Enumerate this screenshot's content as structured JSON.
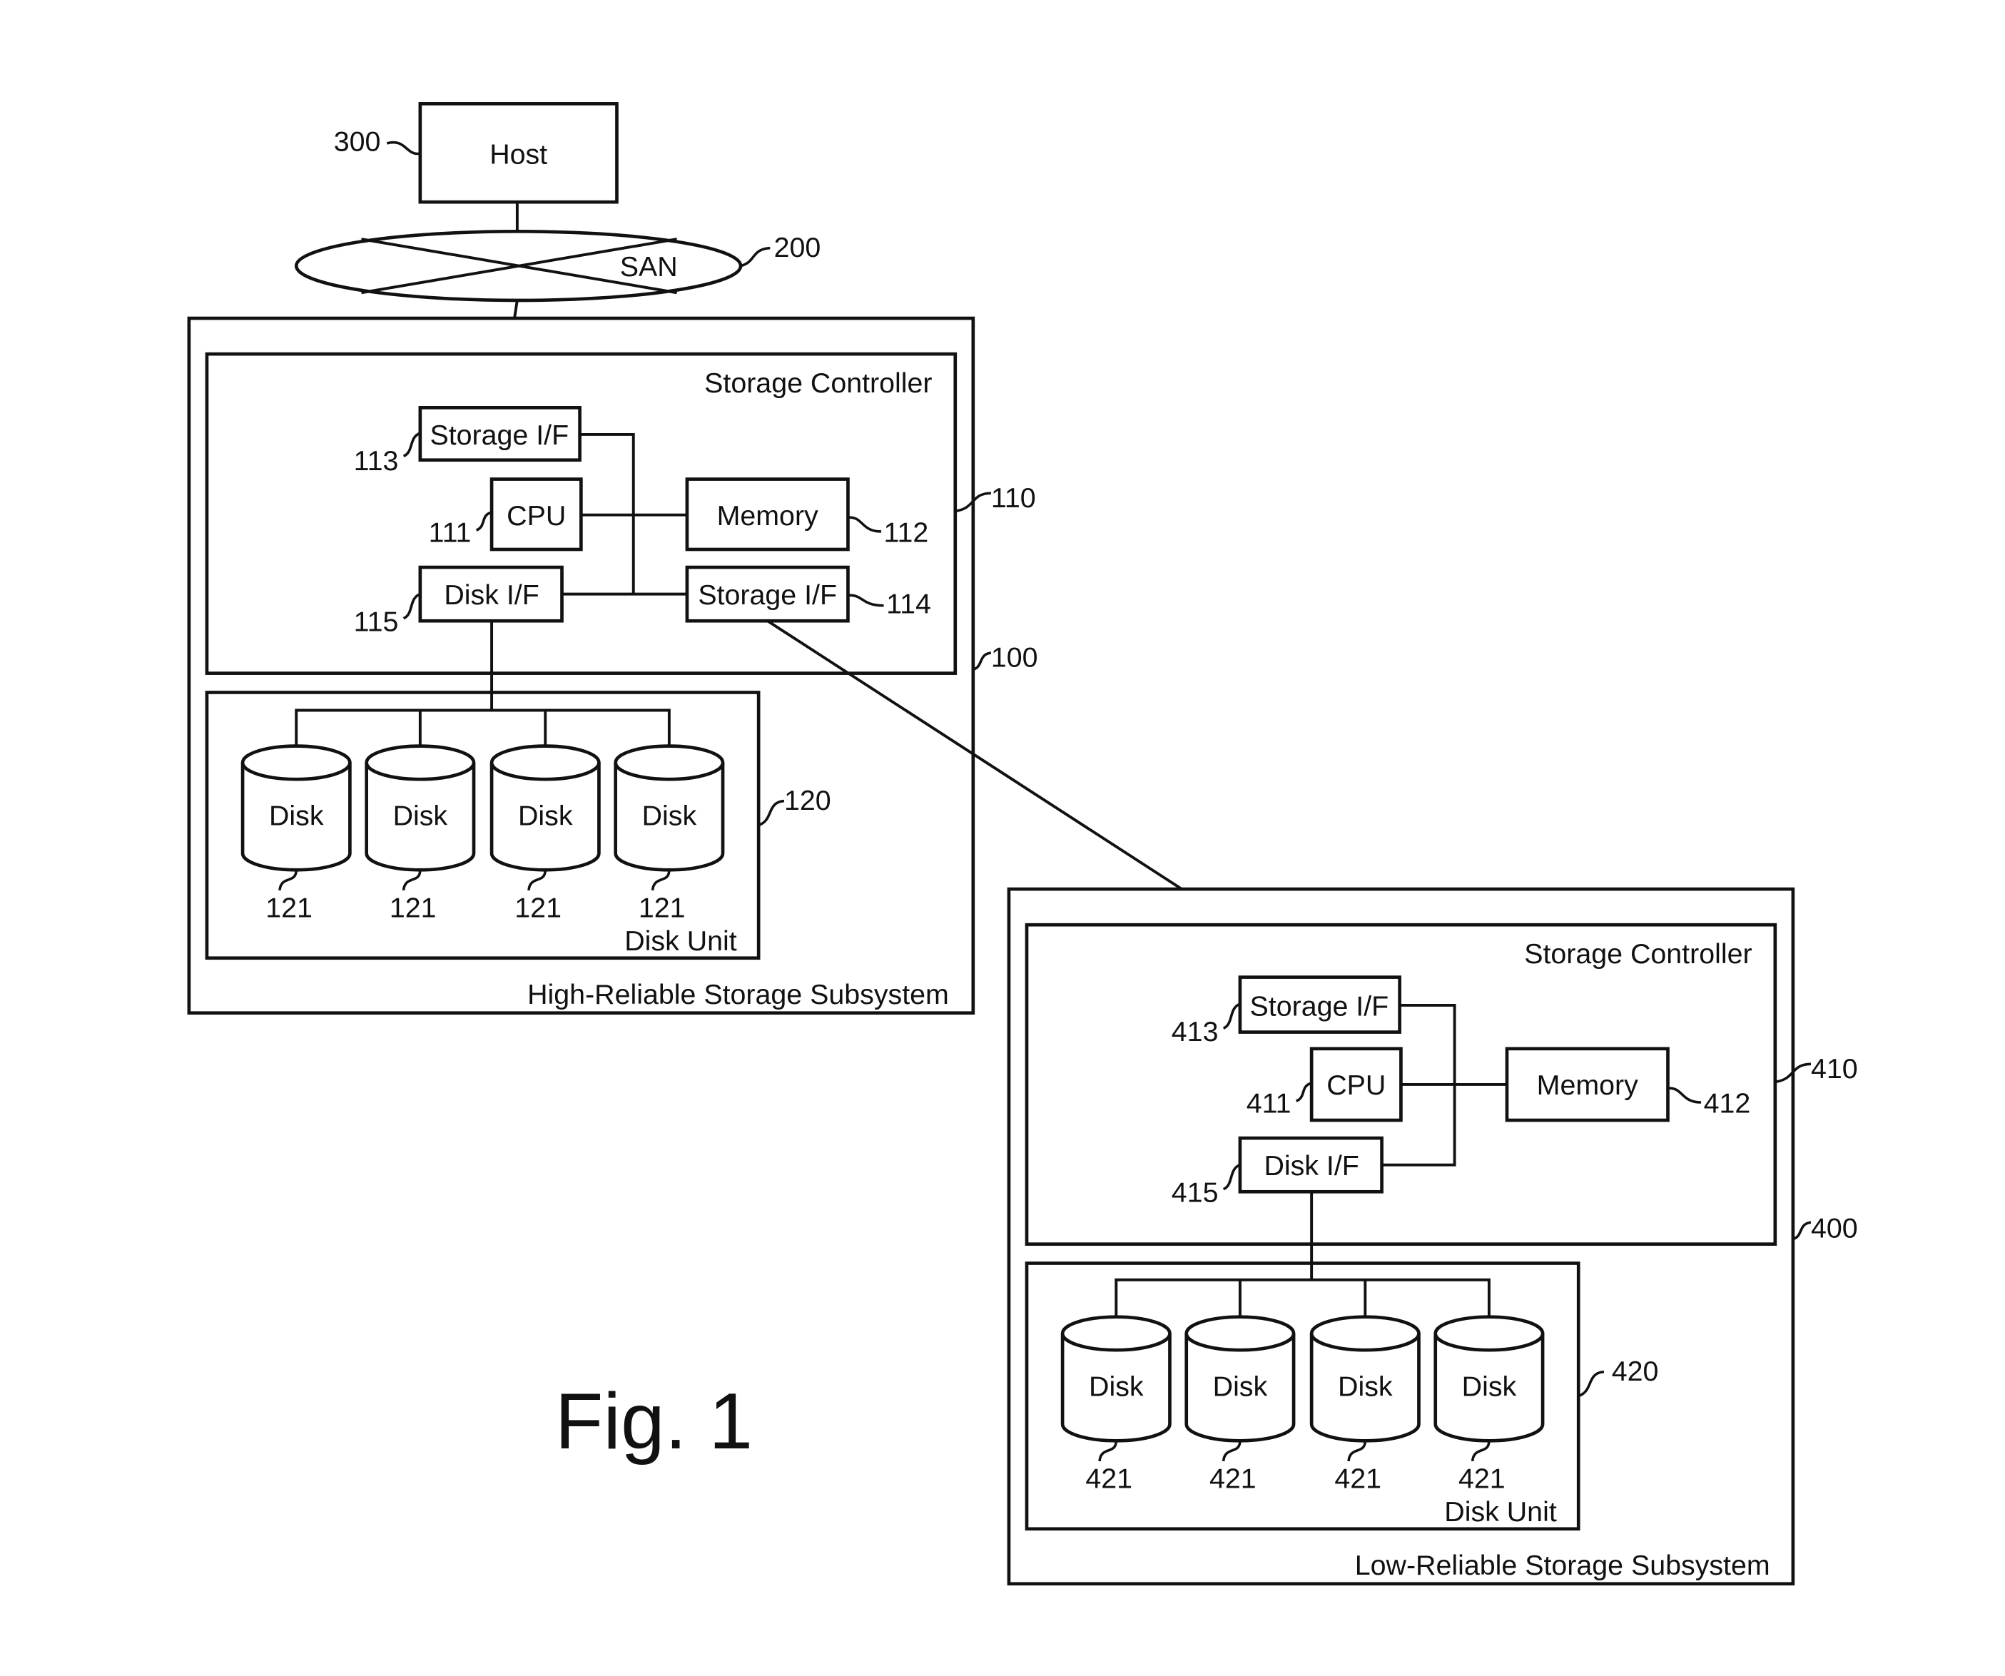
{
  "figure": {
    "caption": "Fig. 1"
  },
  "host": {
    "label": "Host",
    "ref": "300"
  },
  "san": {
    "label": "SAN",
    "ref": "200"
  },
  "high_subsystem": {
    "label": "High-Reliable Storage Subsystem",
    "ref": "100",
    "controller": {
      "label": "Storage Controller",
      "ref": "110",
      "storage_if_upper": {
        "label": "Storage I/F",
        "ref": "113"
      },
      "cpu": {
        "label": "CPU",
        "ref": "111"
      },
      "memory": {
        "label": "Memory",
        "ref": "112"
      },
      "disk_if": {
        "label": "Disk I/F",
        "ref": "115"
      },
      "storage_if_lower": {
        "label": "Storage I/F",
        "ref": "114"
      }
    },
    "disk_unit": {
      "label": "Disk Unit",
      "ref": "120",
      "disks": [
        {
          "label": "Disk",
          "ref": "121"
        },
        {
          "label": "Disk",
          "ref": "121"
        },
        {
          "label": "Disk",
          "ref": "121"
        },
        {
          "label": "Disk",
          "ref": "121"
        }
      ]
    }
  },
  "low_subsystem": {
    "label": "Low-Reliable Storage Subsystem",
    "ref": "400",
    "controller": {
      "label": "Storage Controller",
      "ref": "410",
      "storage_if": {
        "label": "Storage I/F",
        "ref": "413"
      },
      "cpu": {
        "label": "CPU",
        "ref": "411"
      },
      "memory": {
        "label": "Memory",
        "ref": "412"
      },
      "disk_if": {
        "label": "Disk I/F",
        "ref": "415"
      }
    },
    "disk_unit": {
      "label": "Disk Unit",
      "ref": "420",
      "disks": [
        {
          "label": "Disk",
          "ref": "421"
        },
        {
          "label": "Disk",
          "ref": "421"
        },
        {
          "label": "Disk",
          "ref": "421"
        },
        {
          "label": "Disk",
          "ref": "421"
        }
      ]
    }
  }
}
